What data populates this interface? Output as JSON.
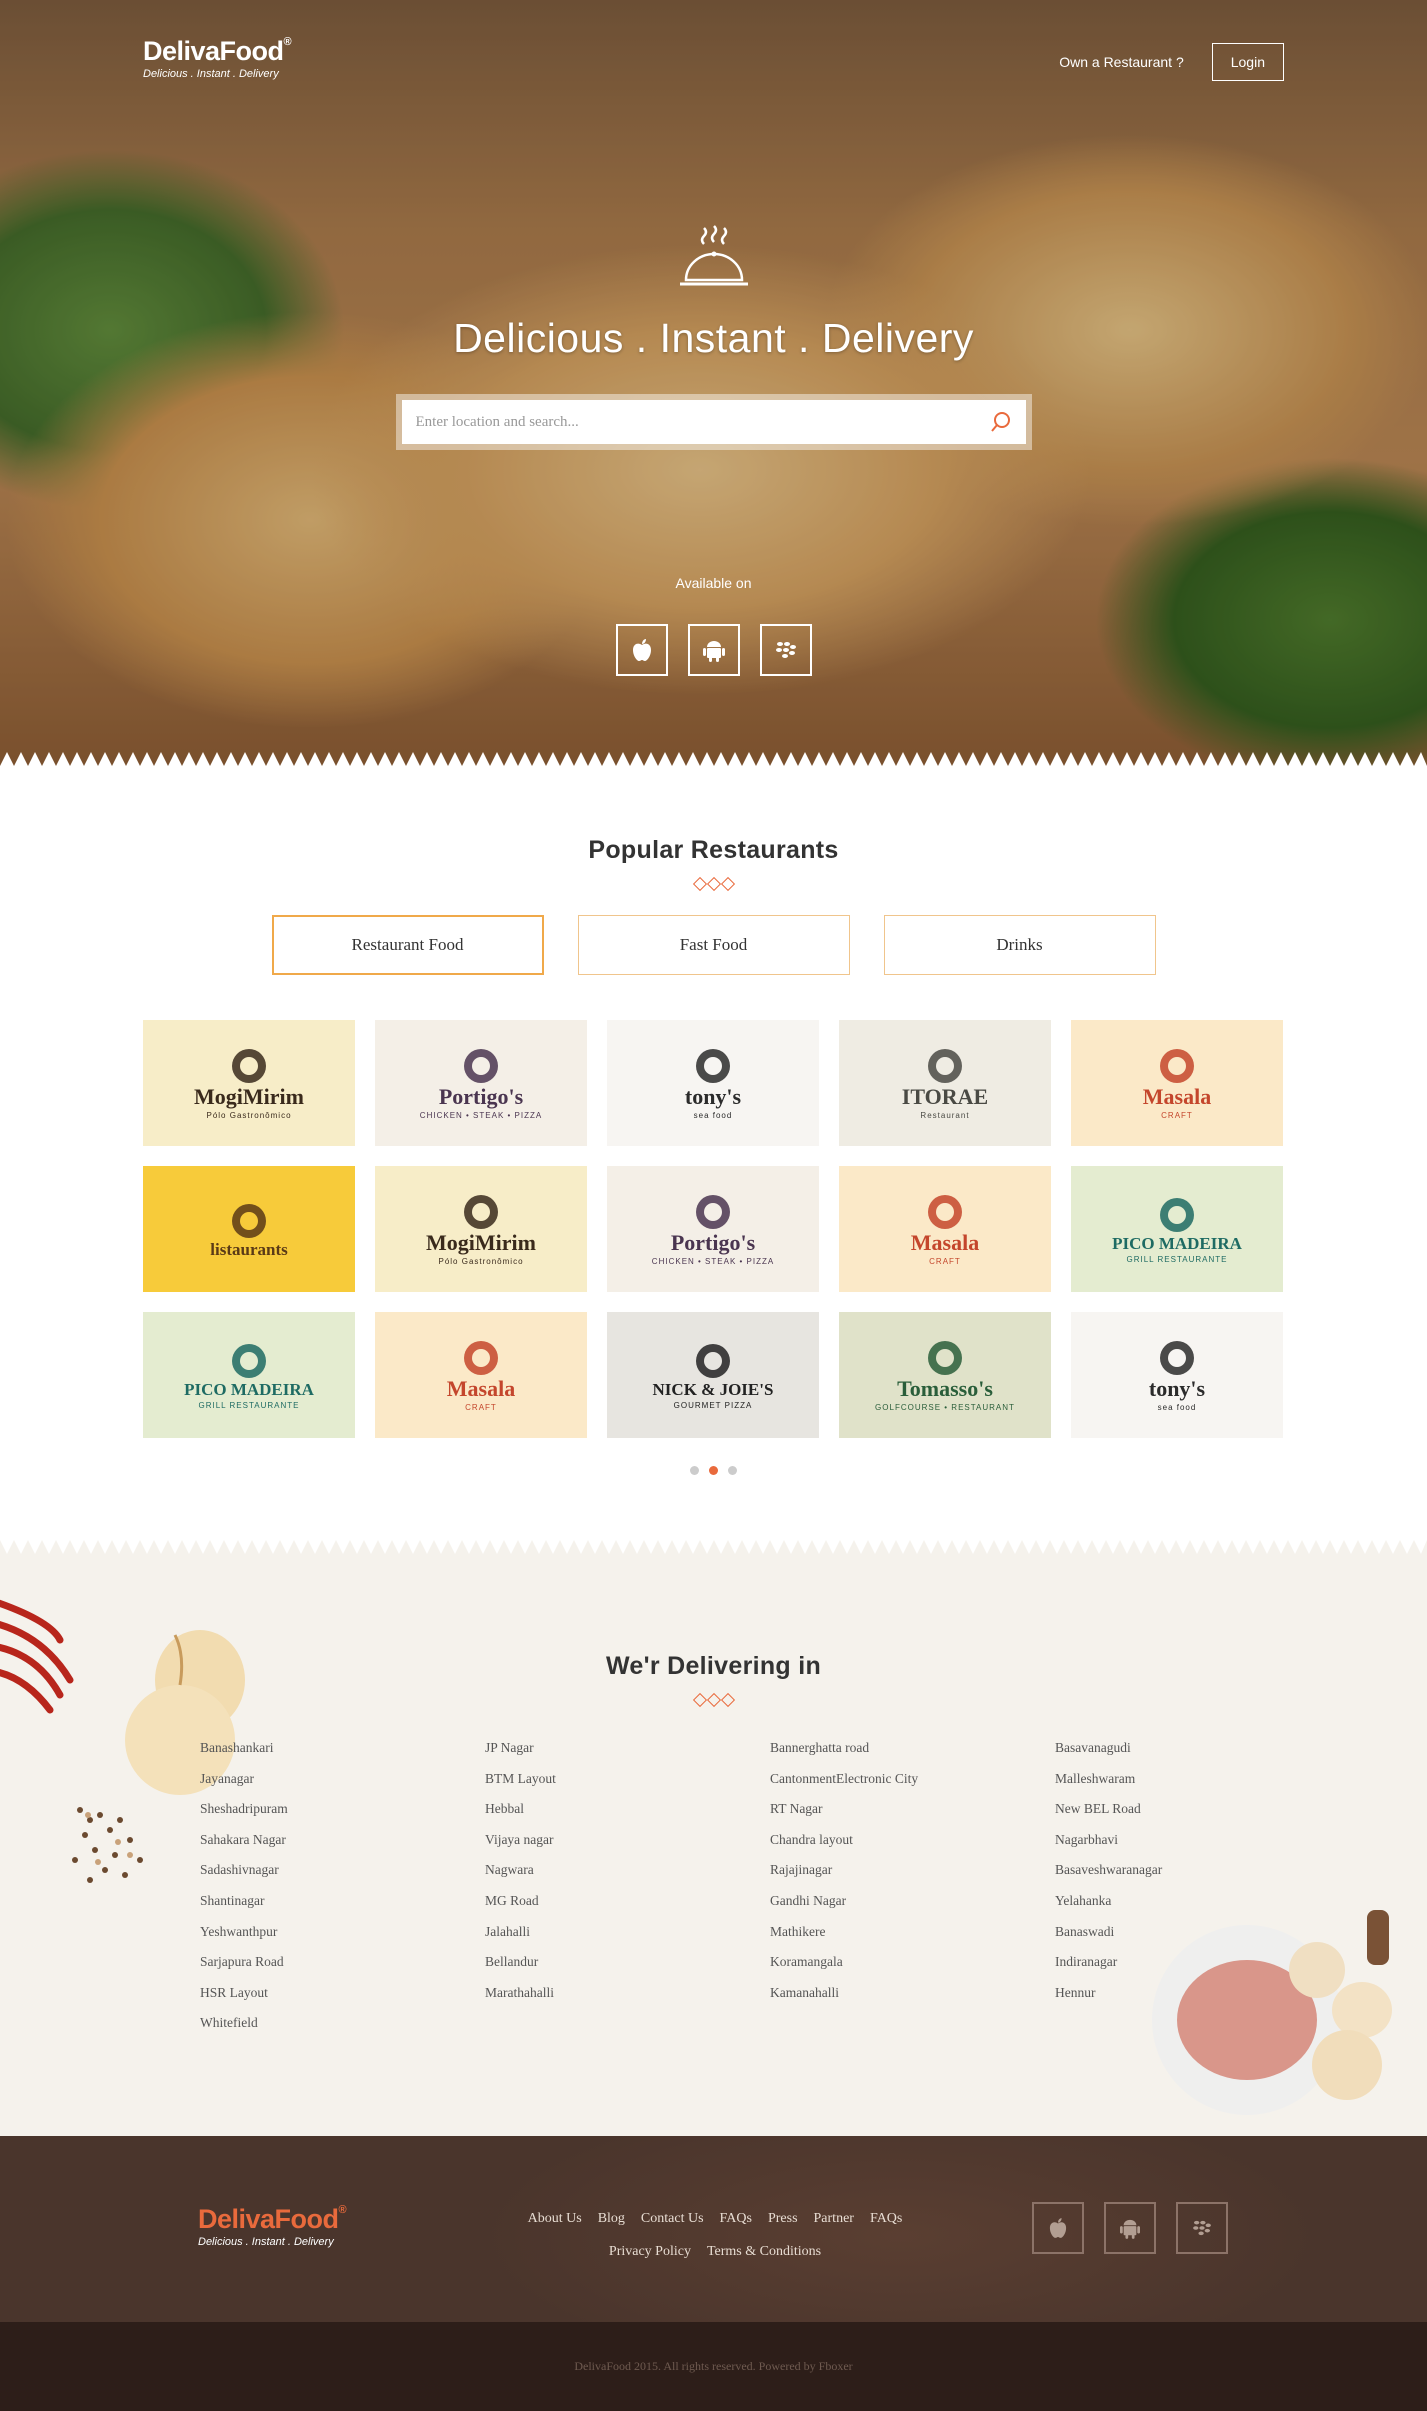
{
  "header": {
    "brand": "DelivaFood",
    "reg": "®",
    "tagline": "Delicious . Instant . Delivery",
    "own_restaurant": "Own a Restaurant ?",
    "login": "Login"
  },
  "hero": {
    "title": "Delicious . Instant . Delivery",
    "search_placeholder": "Enter location and search...",
    "available_on": "Available on",
    "apps": [
      "apple-icon",
      "android-icon",
      "blackberry-icon"
    ]
  },
  "popular": {
    "title": "Popular Restaurants",
    "tabs": [
      "Restaurant Food",
      "Fast Food",
      "Drinks"
    ],
    "active_tab": "Restaurant Food",
    "restaurants": [
      {
        "name": "MogiMirim",
        "sub": "Pólo Gastronômico",
        "bg": "#f7edc8",
        "color": "#3a2a1c"
      },
      {
        "name": "Portigo's",
        "sub": "CHICKEN • STEAK • PIZZA",
        "bg": "#f4efe7",
        "color": "#4a3550"
      },
      {
        "name": "tony's",
        "sub": "sea food",
        "bg": "#f7f5f2",
        "color": "#2b2b2b"
      },
      {
        "name": "ITORAE",
        "sub": "Restaurant",
        "bg": "#efece3",
        "color": "#4a4a44"
      },
      {
        "name": "Masala",
        "sub": "CRAFT",
        "bg": "#fbe9c8",
        "color": "#c4462c"
      },
      {
        "name": "listaurants",
        "sub": "",
        "bg": "#f7cb3a",
        "color": "#5a3a16"
      },
      {
        "name": "MogiMirim",
        "sub": "Pólo Gastronômico",
        "bg": "#f7edc8",
        "color": "#3a2a1c"
      },
      {
        "name": "Portigo's",
        "sub": "CHICKEN • STEAK • PIZZA",
        "bg": "#f4efe7",
        "color": "#4a3550"
      },
      {
        "name": "Masala",
        "sub": "CRAFT",
        "bg": "#fbe9c8",
        "color": "#c4462c"
      },
      {
        "name": "PICO MADEIRA",
        "sub": "GRILL RESTAURANTE",
        "bg": "#e4ecd0",
        "color": "#1e6b63"
      },
      {
        "name": "PICO MADEIRA",
        "sub": "GRILL RESTAURANTE",
        "bg": "#e4ecd0",
        "color": "#1e6b63"
      },
      {
        "name": "Masala",
        "sub": "CRAFT",
        "bg": "#fbe9c8",
        "color": "#c4462c"
      },
      {
        "name": "NICK & JOIE'S",
        "sub": "GOURMET PIZZA",
        "bg": "#e7e5e0",
        "color": "#222"
      },
      {
        "name": "Tomasso's",
        "sub": "GOLFCOURSE • RESTAURANT",
        "bg": "#e0e2c9",
        "color": "#2a5e3a"
      },
      {
        "name": "tony's",
        "sub": "sea food",
        "bg": "#f7f5f2",
        "color": "#2b2b2b"
      }
    ],
    "pages": 3,
    "current_page": 2
  },
  "delivering": {
    "title": "We'r Delivering in",
    "columns": [
      [
        "Banashankari",
        "Jayanagar",
        "Sheshadripuram",
        "Sahakara Nagar",
        "Sadashivnagar",
        "Shantinagar",
        "Yeshwanthpur",
        "Sarjapura Road",
        "HSR Layout",
        "Whitefield"
      ],
      [
        "JP Nagar",
        "BTM Layout",
        "Hebbal",
        "Vijaya nagar",
        "Nagwara",
        "MG Road",
        "Jalahalli",
        "Bellandur",
        "Marathahalli"
      ],
      [
        "Bannerghatta road",
        "CantonmentElectronic City",
        "RT Nagar",
        "Chandra layout",
        "Rajajinagar",
        "Gandhi Nagar",
        "Mathikere",
        "Koramangala",
        "Kamanahalli"
      ],
      [
        "Basavanagudi",
        "Malleshwaram",
        "New BEL Road",
        "Nagarbhavi",
        "Basaveshwaranagar",
        "Yelahanka",
        "Banaswadi",
        "Indiranagar",
        "Hennur"
      ]
    ]
  },
  "footer": {
    "brand": "DelivaFood",
    "reg": "®",
    "tagline": "Delicious . Instant . Delivery",
    "links_row1": [
      "About Us",
      "Blog",
      "Contact Us",
      "FAQs",
      "Press",
      "Partner",
      "FAQs"
    ],
    "links_row2": [
      "Privacy Policy",
      "Terms & Conditions"
    ],
    "copyright": "DelivaFood 2015. All rights reserved. Powered by Fboxer"
  },
  "colors": {
    "accent": "#e96a3c",
    "tab_border": "#f0c58c",
    "footer_bg": "#4a352c",
    "copy_bg": "#2d1e19"
  }
}
